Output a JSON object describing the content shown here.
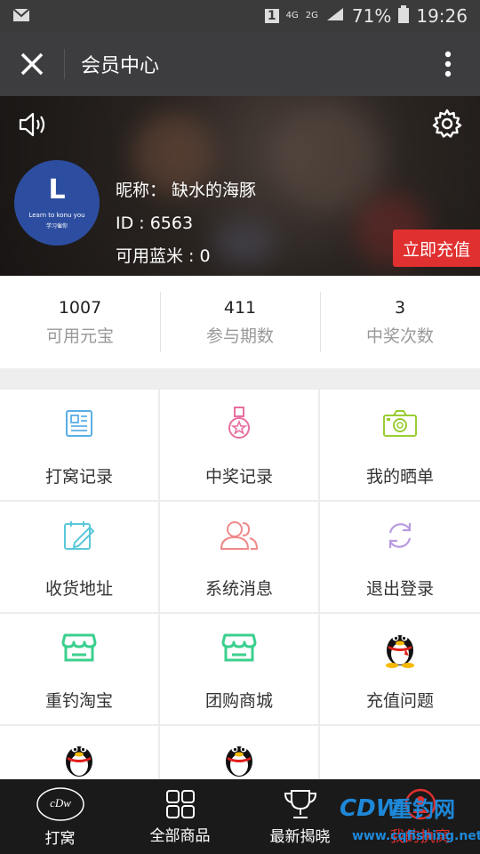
{
  "status": {
    "battery": "71%",
    "time": "19:26",
    "sim": "1",
    "net1": "4G",
    "net2": "2G"
  },
  "header": {
    "title": "会员中心"
  },
  "profile": {
    "nickname": "昵称： 缺水的海豚",
    "id": "ID : 6563",
    "balance": "可用蓝米 : 0",
    "recharge_label": "立即充值",
    "avatar_letter": "L",
    "avatar_tagline": "Learn to konu you",
    "avatar_sub": "学习催你"
  },
  "stats": [
    {
      "value": "1007",
      "label": "可用元宝"
    },
    {
      "value": "411",
      "label": "参与期数"
    },
    {
      "value": "3",
      "label": "中奖次数"
    }
  ],
  "menu": [
    {
      "label": "打窝记录",
      "icon": "document-icon",
      "color": "#5aaee6"
    },
    {
      "label": "中奖记录",
      "icon": "medal-icon",
      "color": "#e86fa0"
    },
    {
      "label": "我的晒单",
      "icon": "camera-icon",
      "color": "#9acd32"
    },
    {
      "label": "收货地址",
      "icon": "calendar-edit-icon",
      "color": "#5ac8d8"
    },
    {
      "label": "系统消息",
      "icon": "users-icon",
      "color": "#ef8a8a"
    },
    {
      "label": "退出登录",
      "icon": "refresh-icon",
      "color": "#b99be0"
    },
    {
      "label": "重钓淘宝",
      "icon": "store-icon",
      "color": "#3ccf8e"
    },
    {
      "label": "团购商城",
      "icon": "store-icon",
      "color": "#3ccf8e"
    },
    {
      "label": "充值问题",
      "icon": "qq-penguin-icon",
      "color": "#000000"
    }
  ],
  "tabs": [
    {
      "label": "打窝",
      "icon": "cdw-logo-icon"
    },
    {
      "label": "全部商品",
      "icon": "grid-icon"
    },
    {
      "label": "最新揭晓",
      "icon": "trophy-icon"
    },
    {
      "label": "我的执窝",
      "icon": "user-icon"
    }
  ],
  "watermark": {
    "logo": "CDW",
    "name": "重钓网",
    "url": "www.cqfishing.net"
  }
}
